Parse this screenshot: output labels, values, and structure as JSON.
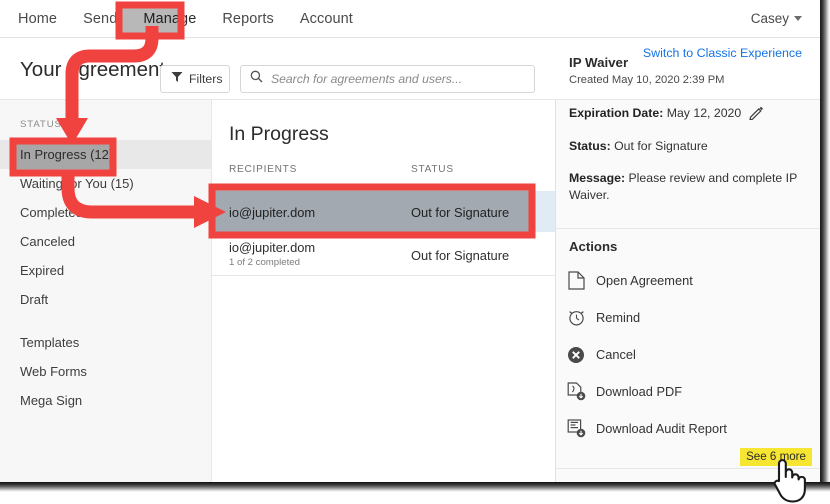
{
  "app": {
    "accent_red": "#f0423e",
    "link_blue": "#1473e6",
    "highlight_yellow": "#f6e531",
    "selected_row_blue": "#e1ebf5"
  },
  "topnav": {
    "items": [
      {
        "label": "Home",
        "name": "nav-home"
      },
      {
        "label": "Send",
        "name": "nav-send"
      },
      {
        "label": "Manage",
        "name": "nav-manage"
      },
      {
        "label": "Reports",
        "name": "nav-reports"
      },
      {
        "label": "Account",
        "name": "nav-account"
      }
    ],
    "user": "Casey"
  },
  "header": {
    "title": "Your agreements",
    "switch_link": "Switch to Classic Experience",
    "filters_label": "Filters",
    "search_placeholder": "Search for agreements and users...",
    "search_value": ""
  },
  "sidebar": {
    "section_label": "STATUS",
    "status_items": [
      {
        "label": "In Progress (12)",
        "selected": true
      },
      {
        "label": "Waiting for You (15)",
        "selected": false
      },
      {
        "label": "Completed",
        "selected": false
      },
      {
        "label": "Canceled",
        "selected": false
      },
      {
        "label": "Expired",
        "selected": false
      },
      {
        "label": "Draft",
        "selected": false
      }
    ],
    "other_items": [
      {
        "label": "Templates"
      },
      {
        "label": "Web Forms"
      },
      {
        "label": "Mega Sign"
      }
    ]
  },
  "list": {
    "title": "In Progress",
    "columns": [
      "RECIPIENTS",
      "STATUS"
    ],
    "rows": [
      {
        "recipient": "io@jupiter.dom",
        "status": "Out for Signature",
        "sub": "",
        "selected": true
      },
      {
        "recipient": "io@jupiter.dom",
        "status": "Out for Signature",
        "sub": "1 of 2 completed",
        "selected": false
      }
    ]
  },
  "details": {
    "title": "IP Waiver",
    "created": "Created May 10, 2020 2:39 PM",
    "expiration_label": "Expiration Date:",
    "expiration_value": "May 12, 2020",
    "status_label": "Status:",
    "status_value": "Out for Signature",
    "message_label": "Message:",
    "message_value": "Please review and complete IP Waiver.",
    "actions_title": "Actions",
    "actions": [
      {
        "label": "Open Agreement",
        "icon": "document-icon"
      },
      {
        "label": "Remind",
        "icon": "alarm-clock-icon"
      },
      {
        "label": "Cancel",
        "icon": "circle-x-icon"
      },
      {
        "label": "Download PDF",
        "icon": "download-pdf-icon"
      },
      {
        "label": "Download Audit Report",
        "icon": "download-audit-report-icon"
      }
    ],
    "see_more": "See 6 more"
  }
}
